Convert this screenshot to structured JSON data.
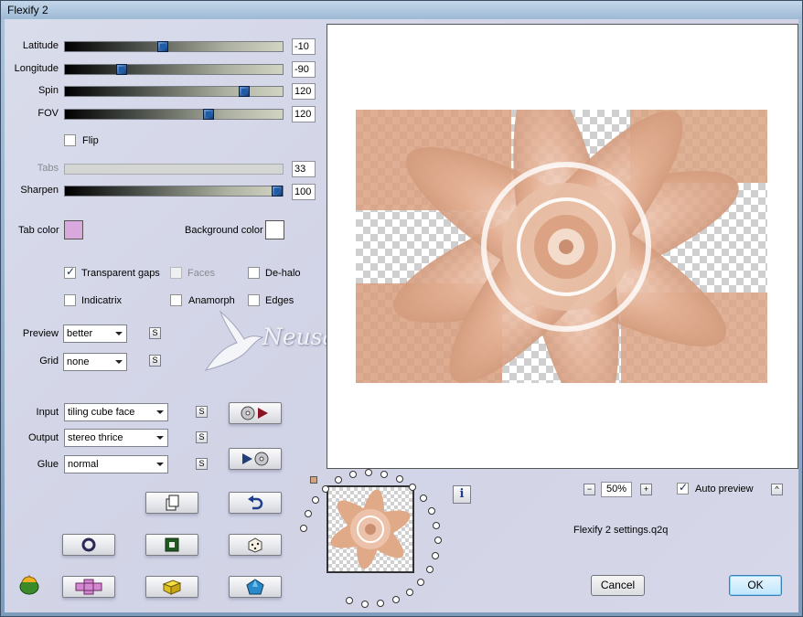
{
  "window": {
    "title": "Flexify 2"
  },
  "sliders": [
    {
      "id": "latitude",
      "label": "Latitude",
      "value": "-10",
      "position": 0.45,
      "enabled": true
    },
    {
      "id": "longitude",
      "label": "Longitude",
      "value": "-90",
      "position": 0.25,
      "enabled": true
    },
    {
      "id": "spin",
      "label": "Spin",
      "value": "120",
      "position": 0.83,
      "enabled": true
    },
    {
      "id": "fov",
      "label": "FOV",
      "value": "120",
      "position": 0.66,
      "enabled": true
    }
  ],
  "flip": {
    "label": "Flip",
    "checked": false
  },
  "tabs": {
    "label": "Tabs",
    "value": "33",
    "enabled": false
  },
  "sharpen": {
    "label": "Sharpen",
    "value": "100",
    "position": 1.0
  },
  "tab_color": {
    "label": "Tab color",
    "color": "#d9a8dc"
  },
  "background_color": {
    "label": "Background color",
    "color": "#ffffff"
  },
  "options": {
    "transparent_gaps": {
      "label": "Transparent gaps",
      "checked": true
    },
    "faces": {
      "label": "Faces",
      "checked": false,
      "enabled": false
    },
    "de_halo": {
      "label": "De-halo",
      "checked": false
    },
    "indicatrix": {
      "label": "Indicatrix",
      "checked": false
    },
    "anamorph": {
      "label": "Anamorph",
      "checked": false
    },
    "edges": {
      "label": "Edges",
      "checked": false
    }
  },
  "preview": {
    "label": "Preview",
    "value": "better"
  },
  "grid": {
    "label": "Grid",
    "value": "none"
  },
  "input": {
    "label": "Input",
    "value": "tiling cube face"
  },
  "output": {
    "label": "Output",
    "value": "stereo thrice"
  },
  "glue": {
    "label": "Glue",
    "value": "normal"
  },
  "small_button_label": "S",
  "zoom": {
    "minus": "−",
    "value": "50%",
    "plus": "+"
  },
  "auto_preview": {
    "label": "Auto preview",
    "checked": true
  },
  "settings_file": "Flexify 2 settings.q2q",
  "buttons": {
    "cancel": "Cancel",
    "ok": "OK"
  },
  "info_label": "i",
  "collapse_label": "^",
  "watermark": "Neusa Novaes",
  "colors": {
    "accent_thumb": "#1e5ca8",
    "art_peach": "#e0a988"
  }
}
